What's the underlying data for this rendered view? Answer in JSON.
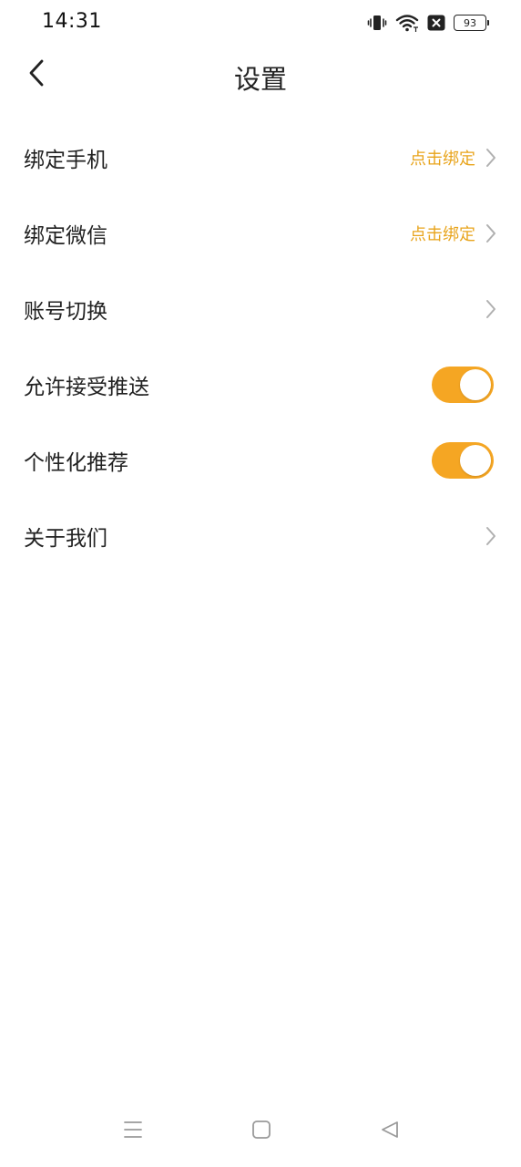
{
  "status_bar": {
    "time": "14:31",
    "battery_level": "93",
    "icons": [
      "vibrate-icon",
      "wifi-icon",
      "no-sim-icon",
      "battery-icon"
    ]
  },
  "header": {
    "title": "设置",
    "back_icon": "chevron-left-icon"
  },
  "settings": [
    {
      "label": "绑定手机",
      "hint": "点击绑定",
      "control": "chevron"
    },
    {
      "label": "绑定微信",
      "hint": "点击绑定",
      "control": "chevron"
    },
    {
      "label": "账号切换",
      "control": "chevron"
    },
    {
      "label": "允许接受推送",
      "control": "toggle",
      "on": true
    },
    {
      "label": "个性化推荐",
      "control": "toggle",
      "on": true
    },
    {
      "label": "关于我们",
      "control": "chevron"
    }
  ],
  "colors": {
    "accent": "#f5a623",
    "hint_text": "#e8a41c",
    "text": "#222222",
    "chevron": "#b0b0b0"
  },
  "nav_bar": {
    "icons": [
      "menu-icon",
      "home-icon",
      "back-triangle-icon"
    ]
  }
}
